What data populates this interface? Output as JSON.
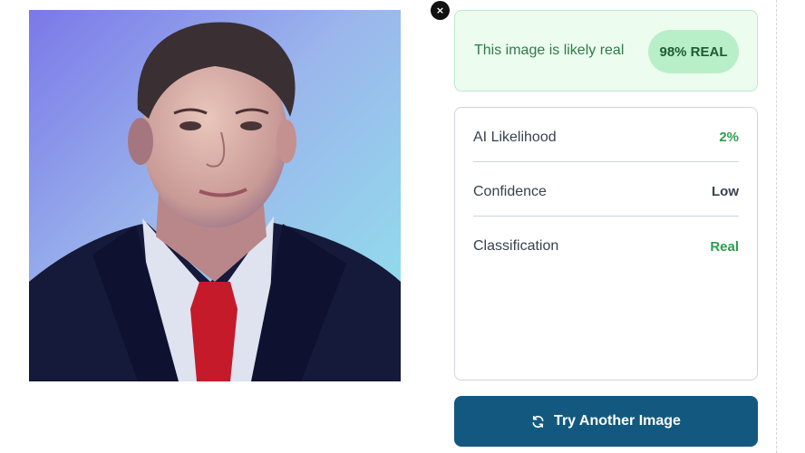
{
  "close_button": {
    "label": "×",
    "icon": "close-icon"
  },
  "verdict": {
    "message": "This image is likely real",
    "badge": "98% REAL",
    "colors": {
      "background": "#ecfdf0",
      "badge": "#b9efc8",
      "text": "#2f7a46"
    }
  },
  "stats": [
    {
      "label": "AI Likelihood",
      "value": "2%",
      "color": "#2f9e4f"
    },
    {
      "label": "Confidence",
      "value": "Low",
      "color": "#374151"
    },
    {
      "label": "Classification",
      "value": "Real",
      "color": "#2f9e4f"
    }
  ],
  "action": {
    "label": "Try Another Image",
    "icon": "refresh-icon",
    "color": "#13597f"
  }
}
